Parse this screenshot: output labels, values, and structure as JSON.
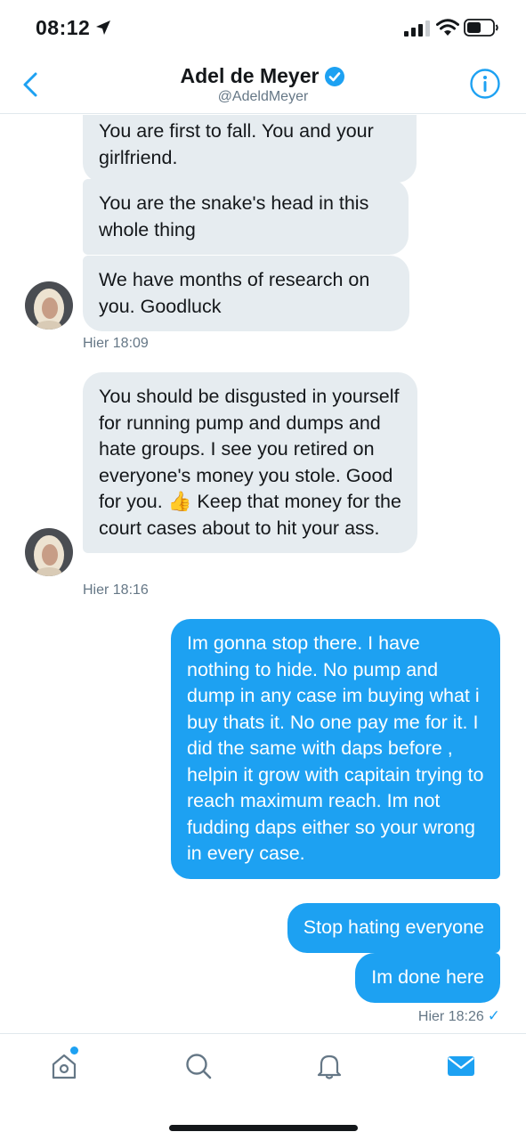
{
  "status_bar": {
    "time": "08:12"
  },
  "header": {
    "title": "Adel de Meyer",
    "handle": "@AdeldMeyer"
  },
  "messages": {
    "m1": "You are first to fall. You and your girlfriend.",
    "m2": "You are the snake's head in this whole thing",
    "m3": "We have months of research on you. Goodluck",
    "ts1": "Hier 18:09",
    "m4": "You should be disgusted in yourself for running pump and dumps and hate groups. I see you retired on everyone's money you stole. Good for you. 👍 Keep that money for the court cases about to hit your ass.",
    "ts2": "Hier 18:16",
    "m5": "Im gonna stop there. I have nothing to hide. No pump and dump in any case im buying what i buy thats it. No one pay me for it. I did the same with daps before , helpin it grow with capitain trying to reach maximum reach. Im not fudding daps either so your wrong in every case.",
    "m6": "Stop hating everyone",
    "m7": "Im done here",
    "ts3": "Hier 18:26"
  },
  "icons": {
    "back": "chevron-left-icon",
    "verified": "verified-badge-icon",
    "info": "info-icon",
    "home": "home-icon",
    "search": "search-icon",
    "notifications": "bell-icon",
    "messages": "envelope-icon"
  },
  "colors": {
    "accent": "#1da1f2",
    "incoming_bubble": "#e6ecf0",
    "secondary_text": "#657786"
  }
}
